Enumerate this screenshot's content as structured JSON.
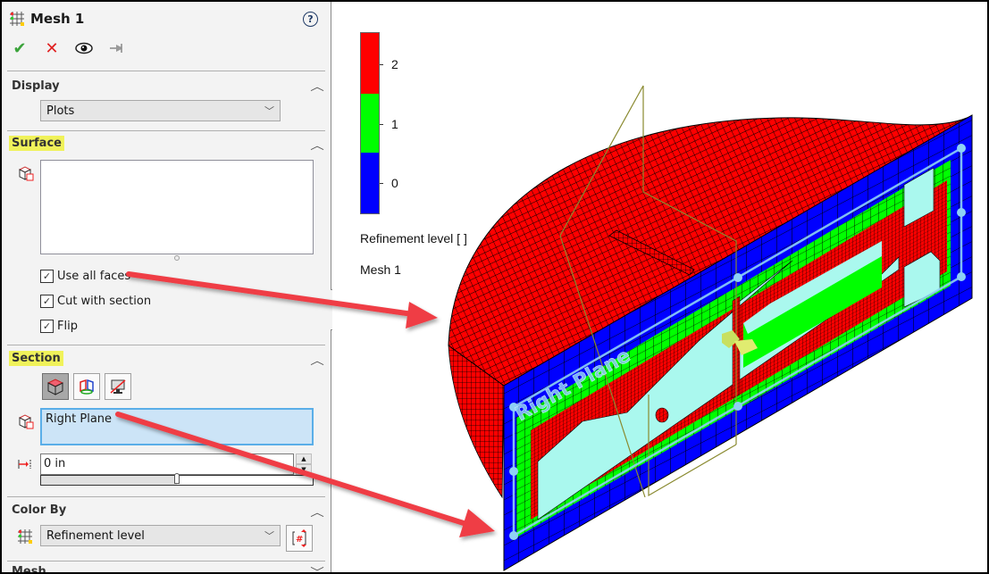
{
  "panel": {
    "title": "Mesh 1",
    "icons": {
      "title": "mesh-grid-icon",
      "help": "help-icon"
    },
    "help_label": "?",
    "actions": [
      {
        "name": "ok",
        "glyph": "✔",
        "icon": "checkmark-icon"
      },
      {
        "name": "cancel",
        "glyph": "✕",
        "icon": "close-icon"
      },
      {
        "name": "preview",
        "glyph": "👁",
        "icon": "eye-icon"
      },
      {
        "name": "pin",
        "glyph": "⊣",
        "icon": "pushpin-icon"
      }
    ],
    "display": {
      "title": "Display",
      "selected": "Plots"
    },
    "surface": {
      "title": "Surface",
      "faces_list": [],
      "checkboxes": [
        {
          "label": "Use all faces",
          "checked": true
        },
        {
          "label": "Cut with section",
          "checked": true
        },
        {
          "label": "Flip",
          "checked": true
        }
      ]
    },
    "section": {
      "title": "Section",
      "mode_buttons": [
        {
          "name": "section-solid",
          "active": true
        },
        {
          "name": "section-plane-colored",
          "active": false
        },
        {
          "name": "section-display-off",
          "active": false
        }
      ],
      "selected_plane": "Right Plane",
      "offset_value": "0 in",
      "offset_slider_fraction": 0.5
    },
    "color_by": {
      "title": "Color By",
      "selected": "Refinement level"
    },
    "next_section_partial": "Mesh"
  },
  "viewport": {
    "legend": {
      "title": "Refinement level [ ]",
      "subtitle": "Mesh 1",
      "levels": [
        {
          "label": "2",
          "color": "#ff0000"
        },
        {
          "label": "1",
          "color": "#00ff00"
        },
        {
          "label": "0",
          "color": "#0000ff"
        }
      ]
    },
    "plane_label": "Right Plane",
    "colors": {
      "level0": "#0000ff",
      "level1": "#00ff00",
      "level2": "#ff0000",
      "fluid": "#aaf8ee",
      "plane_handle": "#8ed0f5",
      "triad": "#8a8a30",
      "annotation_arrow": "#ef3e45"
    }
  }
}
